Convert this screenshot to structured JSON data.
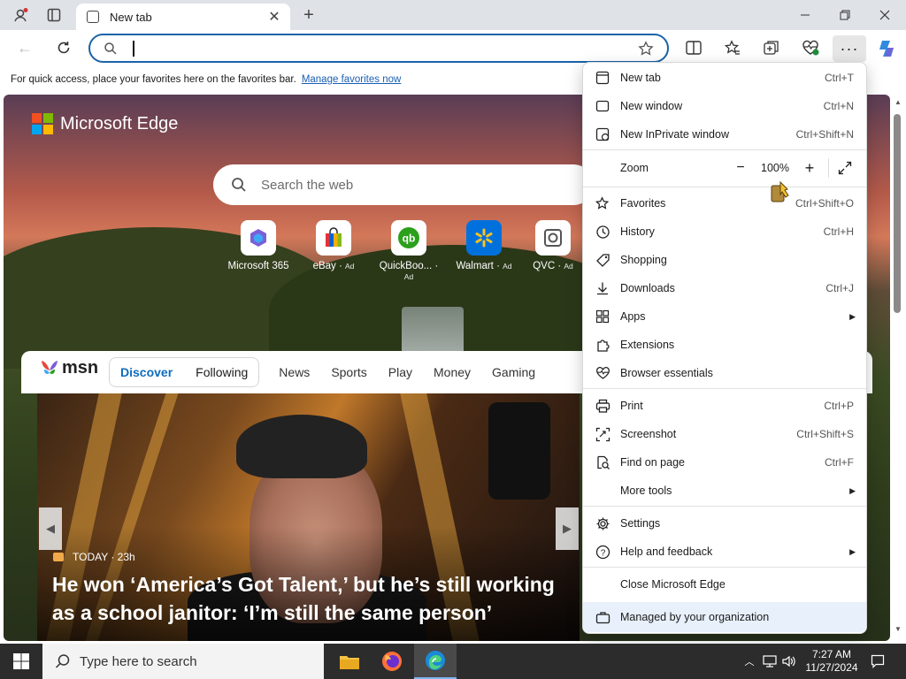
{
  "browser": {
    "tab_title": "New tab",
    "favbar_text": "For quick access, place your favorites here on the favorites bar.",
    "favbar_link": "Manage favorites now"
  },
  "newtab": {
    "logo_text": "Microsoft Edge",
    "search_placeholder": "Search the web",
    "tiles": [
      {
        "label": "Microsoft 365",
        "ad": ""
      },
      {
        "label": "eBay",
        "ad": "Ad"
      },
      {
        "label": "QuickBoo...",
        "ad": "Ad"
      },
      {
        "label": "Walmart",
        "ad": "Ad"
      },
      {
        "label": "QVC",
        "ad": "Ad"
      }
    ]
  },
  "msn": {
    "logo": "msn",
    "tabs": [
      "Discover",
      "Following",
      "News",
      "Sports",
      "Play",
      "Money",
      "Gaming"
    ],
    "source": "TODAY · 23h",
    "headline": "He won ‘America’s Got Talent,’ but he’s still working as a school janitor: ‘I’m still the same person’"
  },
  "menu": {
    "items": [
      {
        "label": "New tab",
        "shortcut": "Ctrl+T",
        "icon": "new-tab-icon"
      },
      {
        "label": "New window",
        "shortcut": "Ctrl+N",
        "icon": "window-icon"
      },
      {
        "label": "New InPrivate window",
        "shortcut": "Ctrl+Shift+N",
        "icon": "inprivate-icon"
      },
      {
        "label": "Zoom",
        "shortcut": "",
        "icon": ""
      },
      {
        "label": "Favorites",
        "shortcut": "Ctrl+Shift+O",
        "icon": "star-list-icon"
      },
      {
        "label": "History",
        "shortcut": "Ctrl+H",
        "icon": "history-icon"
      },
      {
        "label": "Shopping",
        "shortcut": "",
        "icon": "tag-icon"
      },
      {
        "label": "Downloads",
        "shortcut": "Ctrl+J",
        "icon": "download-icon"
      },
      {
        "label": "Apps",
        "shortcut": "",
        "icon": "apps-icon"
      },
      {
        "label": "Extensions",
        "shortcut": "",
        "icon": "puzzle-icon"
      },
      {
        "label": "Browser essentials",
        "shortcut": "",
        "icon": "heart-pulse-icon"
      },
      {
        "label": "Print",
        "shortcut": "Ctrl+P",
        "icon": "printer-icon"
      },
      {
        "label": "Screenshot",
        "shortcut": "Ctrl+Shift+S",
        "icon": "screenshot-icon"
      },
      {
        "label": "Find on page",
        "shortcut": "Ctrl+F",
        "icon": "find-icon"
      },
      {
        "label": "More tools",
        "shortcut": "",
        "icon": ""
      },
      {
        "label": "Settings",
        "shortcut": "",
        "icon": "gear-icon"
      },
      {
        "label": "Help and feedback",
        "shortcut": "",
        "icon": "help-icon"
      },
      {
        "label": "Close Microsoft Edge",
        "shortcut": "",
        "icon": ""
      },
      {
        "label": "Managed by your organization",
        "shortcut": "",
        "icon": "briefcase-icon"
      }
    ],
    "zoom_value": "100%"
  },
  "taskbar": {
    "search_placeholder": "Type here to search",
    "time": "7:27 AM",
    "date": "11/27/2024"
  }
}
